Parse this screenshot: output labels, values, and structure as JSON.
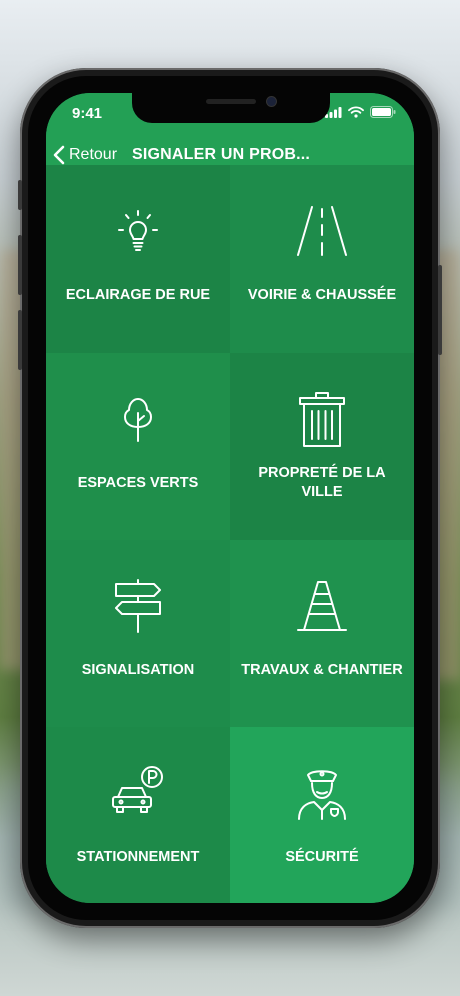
{
  "status_bar": {
    "time": "9:41"
  },
  "nav": {
    "back_label": "Retour",
    "title": "SIGNALER UN PROB..."
  },
  "tiles": [
    {
      "label": "ECLAIRAGE DE RUE",
      "icon": "lightbulb-icon"
    },
    {
      "label": "VOIRIE & CHAUSSÉE",
      "icon": "road-icon"
    },
    {
      "label": "ESPACES VERTS",
      "icon": "tree-icon"
    },
    {
      "label": "PROPRETÉ DE LA VILLE",
      "icon": "trash-can-icon"
    },
    {
      "label": "SIGNALISATION",
      "icon": "signpost-icon"
    },
    {
      "label": "TRAVAUX & CHANTIER",
      "icon": "traffic-cone-icon"
    },
    {
      "label": "STATIONNEMENT",
      "icon": "parking-car-icon"
    },
    {
      "label": "SÉCURITÉ",
      "icon": "police-officer-icon"
    }
  ],
  "colors": {
    "primary": "#23a055",
    "tile_dark": "#1c8446",
    "tile_light": "#22a55a"
  }
}
